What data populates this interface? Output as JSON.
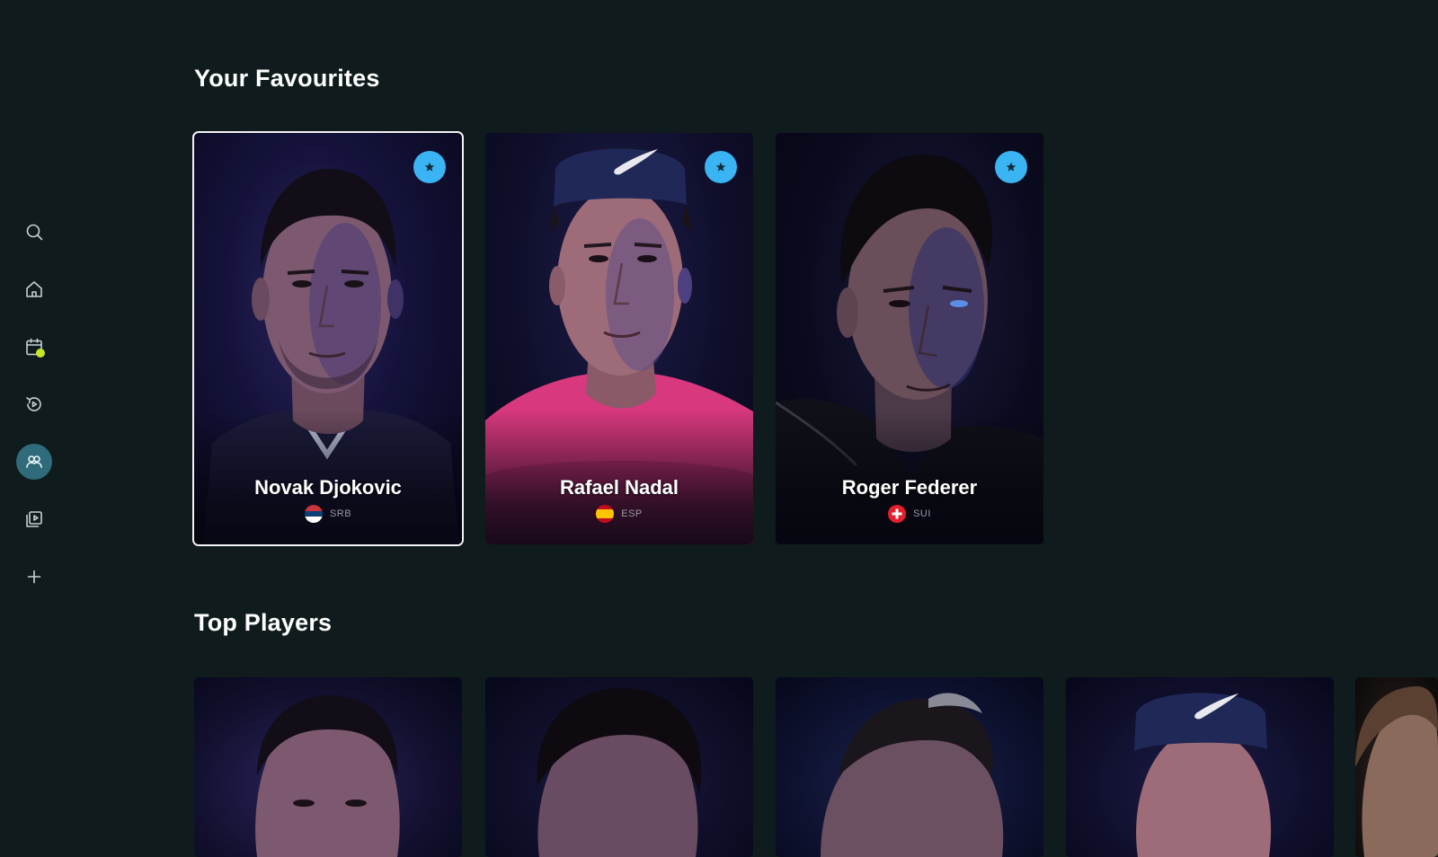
{
  "colors": {
    "background": "#0f1b1d",
    "favourite_badge": "#3ab4f2",
    "active_nav": "#2f6b7a",
    "notification_dot": "#c6e62a",
    "focus_border": "#f2f2f2"
  },
  "sidebar": {
    "items": [
      {
        "name": "search",
        "icon": "search-icon",
        "active": false
      },
      {
        "name": "home",
        "icon": "home-icon",
        "active": false
      },
      {
        "name": "schedule",
        "icon": "calendar-icon",
        "active": false,
        "notification": true
      },
      {
        "name": "replays",
        "icon": "replay-icon",
        "active": false
      },
      {
        "name": "players",
        "icon": "players-icon",
        "active": true
      },
      {
        "name": "videos",
        "icon": "video-library-icon",
        "active": false
      },
      {
        "name": "more",
        "icon": "plus-icon",
        "active": false
      }
    ]
  },
  "favourites": {
    "title": "Your Favourites",
    "players": [
      {
        "name": "Novak Djokovic",
        "country": "SRB",
        "flag": "serbia-flag",
        "focused": true
      },
      {
        "name": "Rafael Nadal",
        "country": "ESP",
        "flag": "spain-flag",
        "focused": false
      },
      {
        "name": "Roger Federer",
        "country": "SUI",
        "flag": "switzerland-flag",
        "focused": false
      }
    ]
  },
  "top_players": {
    "title": "Top Players"
  }
}
